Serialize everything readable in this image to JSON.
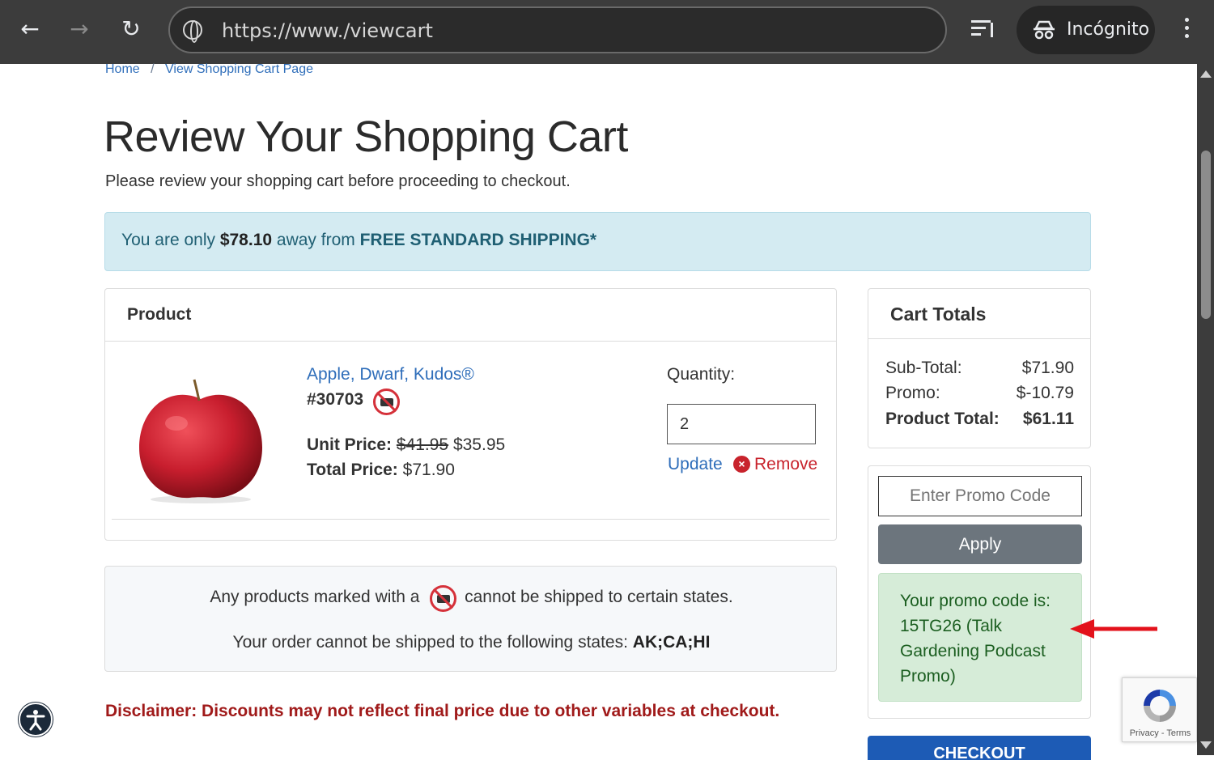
{
  "browser": {
    "url": "https://www./viewcart",
    "incognito_label": "Incógnito"
  },
  "breadcrumb": {
    "home": "Home",
    "separator": "/",
    "current": "View Shopping Cart Page"
  },
  "page": {
    "title": "Review Your Shopping Cart",
    "subtitle": "Please review your shopping cart before proceeding to checkout."
  },
  "shipping_banner": {
    "prefix": "You are only",
    "amount": "$78.10",
    "middle": "away from",
    "highlight": "FREE STANDARD SHIPPING*"
  },
  "product_card": {
    "header": "Product",
    "item": {
      "name": "Apple, Dwarf, Kudos®",
      "sku": "#30703",
      "unit_price_label": "Unit Price:",
      "unit_price_old": "$41.95",
      "unit_price_new": "$35.95",
      "total_price_label": "Total Price:",
      "total_price": "$71.90",
      "quantity_label": "Quantity:",
      "quantity": "2",
      "update_label": "Update",
      "remove_label": "Remove"
    }
  },
  "notice": {
    "line1_prefix": "Any products marked with a",
    "line1_suffix": "cannot be shipped to certain states.",
    "line2_prefix": "Your order cannot be shipped to the following states:",
    "states": "AK;CA;HI"
  },
  "disclaimer": "Disclaimer: Discounts may not reflect final price due to other variables at checkout.",
  "cart_totals": {
    "header": "Cart Totals",
    "rows": [
      {
        "label": "Sub-Total:",
        "value": "$71.90"
      },
      {
        "label": "Promo:",
        "value": "$-10.79"
      },
      {
        "label": "Product Total:",
        "value": "$61.11"
      }
    ]
  },
  "promo": {
    "placeholder": "Enter Promo Code",
    "apply_label": "Apply",
    "success_message": "Your promo code is: 15TG26 (Talk Gardening Podcast Promo)"
  },
  "checkout": {
    "label": "CHECKOUT"
  },
  "recaptcha": {
    "privacy": "Privacy",
    "separator": "-",
    "terms": "Terms"
  },
  "colors": {
    "accent_link": "#2f6eba",
    "remove_red": "#c8232c",
    "disclaimer_red": "#a01a1a",
    "banner_bg": "#d4ebf2",
    "promo_success_bg": "#d6ecd8",
    "apply_gray": "#6c757d",
    "checkout_blue": "#1d5bb5"
  }
}
